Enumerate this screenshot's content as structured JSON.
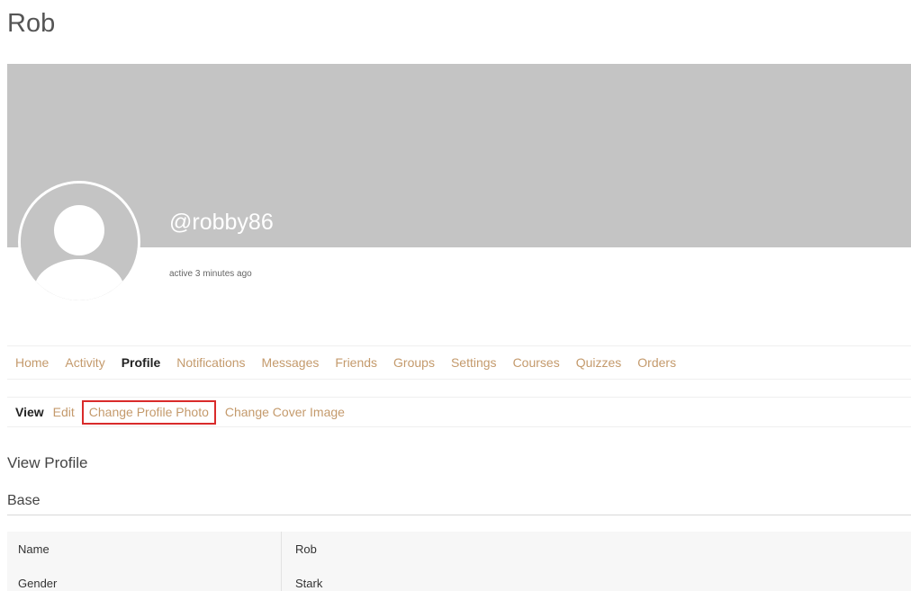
{
  "page": {
    "title": "Rob"
  },
  "profile": {
    "handle": "@robby86",
    "last_active": "active 3 minutes ago",
    "cover_color": "#c4c4c4"
  },
  "nav_primary": [
    {
      "label": "Home",
      "active": false
    },
    {
      "label": "Activity",
      "active": false
    },
    {
      "label": "Profile",
      "active": true
    },
    {
      "label": "Notifications",
      "active": false
    },
    {
      "label": "Messages",
      "active": false
    },
    {
      "label": "Friends",
      "active": false
    },
    {
      "label": "Groups",
      "active": false
    },
    {
      "label": "Settings",
      "active": false
    },
    {
      "label": "Courses",
      "active": false
    },
    {
      "label": "Quizzes",
      "active": false
    },
    {
      "label": "Orders",
      "active": false
    }
  ],
  "nav_sub": [
    {
      "label": "View",
      "active": true,
      "highlighted": false
    },
    {
      "label": "Edit",
      "active": false,
      "highlighted": false
    },
    {
      "label": "Change Profile Photo",
      "active": false,
      "highlighted": true
    },
    {
      "label": "Change Cover Image",
      "active": false,
      "highlighted": false
    }
  ],
  "content": {
    "section_title": "View Profile",
    "group_title": "Base",
    "fields": [
      {
        "label": "Name",
        "value": "Rob"
      },
      {
        "label": "Gender",
        "value": "Stark"
      }
    ]
  },
  "colors": {
    "link": "#c49a6c",
    "highlight_border": "#d92b2b",
    "active_text": "#222222"
  },
  "icons": {
    "avatar": "default-user-silhouette-icon"
  }
}
